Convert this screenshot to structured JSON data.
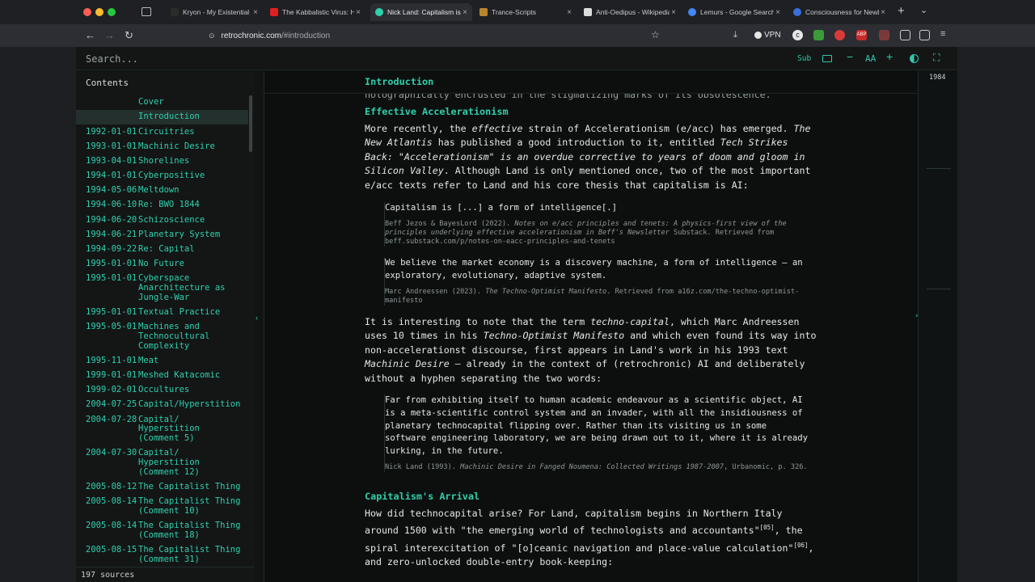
{
  "browser": {
    "tabs": [
      {
        "label": "Kryon - My Existential H",
        "fav_color": "#2b2b2b"
      },
      {
        "label": "The Kabbalistic Virus: H",
        "fav_color": "#e02020"
      },
      {
        "label": "Nick Land: Capitalism is",
        "fav_color": "#2fd0ad"
      },
      {
        "label": "Trance-Scripts",
        "fav_color": "#b8862e"
      },
      {
        "label": "Anti-Oedipus - Wikipedia",
        "fav_color": "#dcdcdc"
      },
      {
        "label": "Lemurs - Google Search",
        "fav_color": "#4285f4"
      },
      {
        "label": "Consciousness for Newb",
        "fav_color": "#3a6fd8"
      }
    ],
    "url_host": "retrochronic.com",
    "url_path": "/#introduction",
    "vpn_label": "VPN"
  },
  "app": {
    "search_placeholder": "Search...",
    "sub_label": "Sub",
    "font_label": "AA",
    "contents_heading": "Contents",
    "sources_count": "197 sources",
    "rail_year": "1984"
  },
  "toc": [
    {
      "date": "",
      "title": "Cover",
      "active": false
    },
    {
      "date": "",
      "title": "Introduction",
      "active": true
    },
    {
      "date": "1992-01-01",
      "title": "Circuitries"
    },
    {
      "date": "1993-01-01",
      "title": "Machinic Desire"
    },
    {
      "date": "1993-04-01",
      "title": "Shorelines"
    },
    {
      "date": "1994-01-01",
      "title": "Cyberpositive"
    },
    {
      "date": "1994-05-06",
      "title": "Meltdown"
    },
    {
      "date": "1994-06-10",
      "title": "Re: BWO 1844"
    },
    {
      "date": "1994-06-20",
      "title": "Schizoscience"
    },
    {
      "date": "1994-06-21",
      "title": "Planetary System"
    },
    {
      "date": "1994-09-22",
      "title": "Re: Capital"
    },
    {
      "date": "1995-01-01",
      "title": "No Future"
    },
    {
      "date": "1995-01-01",
      "title": "Cyberspace Anarchitecture as Jungle-War"
    },
    {
      "date": "1995-01-01",
      "title": "Textual Practice"
    },
    {
      "date": "1995-05-01",
      "title": "Machines and Technocultural Complexity"
    },
    {
      "date": "1995-11-01",
      "title": "Meat"
    },
    {
      "date": "1999-01-01",
      "title": "Meshed Katacomic"
    },
    {
      "date": "1999-02-01",
      "title": "Occultures"
    },
    {
      "date": "2004-07-25",
      "title": "Capital/Hyperstition"
    },
    {
      "date": "2004-07-28",
      "title": "Capital/ Hyperstition (Comment 5)"
    },
    {
      "date": "2004-07-30",
      "title": "Capital/ Hyperstition (Comment 12)"
    },
    {
      "date": "2005-08-12",
      "title": "The Capitalist Thing"
    },
    {
      "date": "2005-08-14",
      "title": "The Capitalist Thing (Comment 10)"
    },
    {
      "date": "2005-08-14",
      "title": "The Capitalist Thing (Comment 18)"
    },
    {
      "date": "2005-08-15",
      "title": "The Capitalist Thing (Comment 31)"
    }
  ],
  "doc": {
    "section_title": "Introduction",
    "prev_line": "holographically encrusted in the stigmatizing marks of its obsolescence.",
    "h_effective": "Effective Accelerationism",
    "h_arrival": "Capitalism's Arrival",
    "quote1": "Capitalism is [...] a form of intelligence[.]",
    "cite1_a": "Beff Jezos & BayesLord (2022).",
    "cite1_i": "Notes on e/acc principles and tenets: A physics-first view of the principles underlying effective accelerationism in Beff's Newsletter",
    "cite1_b": "Substack. Retrieved from beff.substack.com/p/notes-on-eacc-principles-and-tenets",
    "quote2": "We believe the market economy is a discovery machine, a form of intelligence — an exploratory, evolutionary, adaptive system.",
    "cite2_a": "Marc Andreessen (2023).",
    "cite2_i": "The Techno-Optimist Manifesto",
    "cite2_b": ". Retrieved from a16z.com/the-techno-optimist-manifesto",
    "quote3": "Far from exhibiting itself to human academic endeavour as a scientific object, AI is a meta-scientific control system and an invader, with all the insidiousness of planetary technocapital flipping over. Rather than its visiting us in some software engineering laboratory, we are being drawn out to it, where it is already lurking, in the future.",
    "cite3_a": "Nick Land (1993).",
    "cite3_i": "Machinic Desire in Fanged Noumena: Collected Writings 1987-2007",
    "cite3_b": ", Urbanomic, p. 326.",
    "sup05": "[05]",
    "sup06": "[06]"
  },
  "colors": {
    "accent": "#2fd0ad",
    "bg": "#0d0f0f",
    "panel": "#141616"
  }
}
